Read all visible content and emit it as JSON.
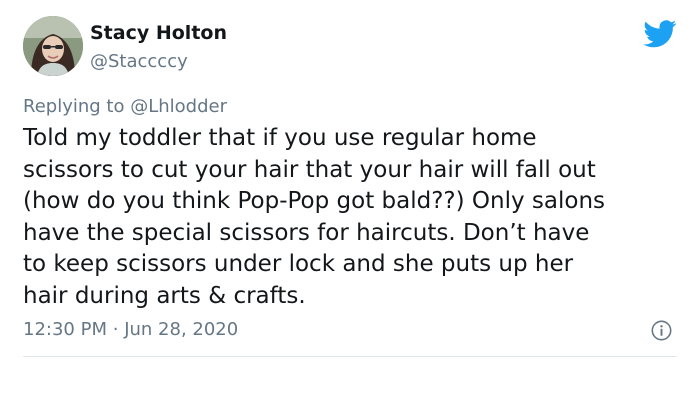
{
  "tweet": {
    "author_name": "Stacy Holton",
    "author_handle": "@Staccccy",
    "reply_prefix": "Replying to",
    "reply_to": "@Lhlodder",
    "text_lines": [
      "Told my toddler that if you use regular home",
      "scissors to cut your hair that your hair will fall out",
      "(how do you think Pop-Pop got bald??) Only salons",
      "have the special scissors for haircuts. Don’t have",
      "to keep scissors under lock and she puts up her",
      "hair during arts & crafts."
    ],
    "time": "12:30 PM",
    "separator": "·",
    "date": "Jun 28, 2020"
  },
  "icons": {
    "brand": "twitter-bird-icon",
    "info": "info-icon"
  },
  "colors": {
    "brand_blue": "#1da1f2",
    "text": "#14171a",
    "secondary_text": "#657786",
    "divider": "#e1e8ed"
  }
}
